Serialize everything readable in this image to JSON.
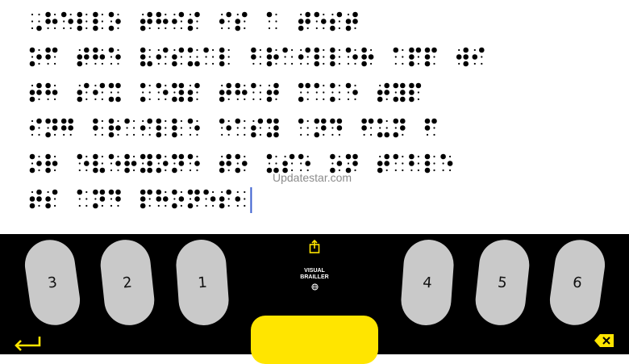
{
  "app": {
    "brand_line1": "VISUAL",
    "brand_line2": "BRAILLER",
    "watermark": "Updatestar.com"
  },
  "colors": {
    "key_gray": "#c9c9c9",
    "yellow": "#ffe500",
    "cursor": "#3a5fcf",
    "dot": "#000000"
  },
  "keys": {
    "left": [
      "3",
      "2",
      "1"
    ],
    "right": [
      "4",
      "5",
      "6"
    ]
  },
  "icons": {
    "share": "share-icon",
    "brand_globe": "globe-icon",
    "return": "return-arrow-icon",
    "backspace": "backspace-icon"
  },
  "braille_lines": [
    "⠠⠓⠑⠇⠇⠕ ⠞⠓⠊⠎ ⠊⠎ ⠁ ⠞⠑⠎⠞",
    "⠕⠋ ⠞⠓⠑ ⠧⠊⠎⠥⠁⠇ ⠃⠗⠁⠊⠇⠇⠑⠗ ⠁⠏⠏ ⠺⠊",
    "⠞⠓ ⠎⠊⠭ ⠅⠑⠽⠎ ⠞⠓⠁⠞ ⠍⠁⠅⠑ ⠞⠽⠏",
    "⠊⠝⠛ ⠃⠗⠁⠊⠇⠇⠑ ⠑⠁⠎⠽ ⠁⠝⠙ ⠋⠥⠝ ⠋",
    "⠕⠗ ⠑⠧⠑⠗⠽⠕⠝⠑ ⠞⠕ ⠥⠎⠑ ⠕⠝ ⠞⠁⠃⠇⠑",
    "⠞⠎ ⠁⠝⠙ ⠏⠓⠕⠝⠑⠎⠂"
  ]
}
